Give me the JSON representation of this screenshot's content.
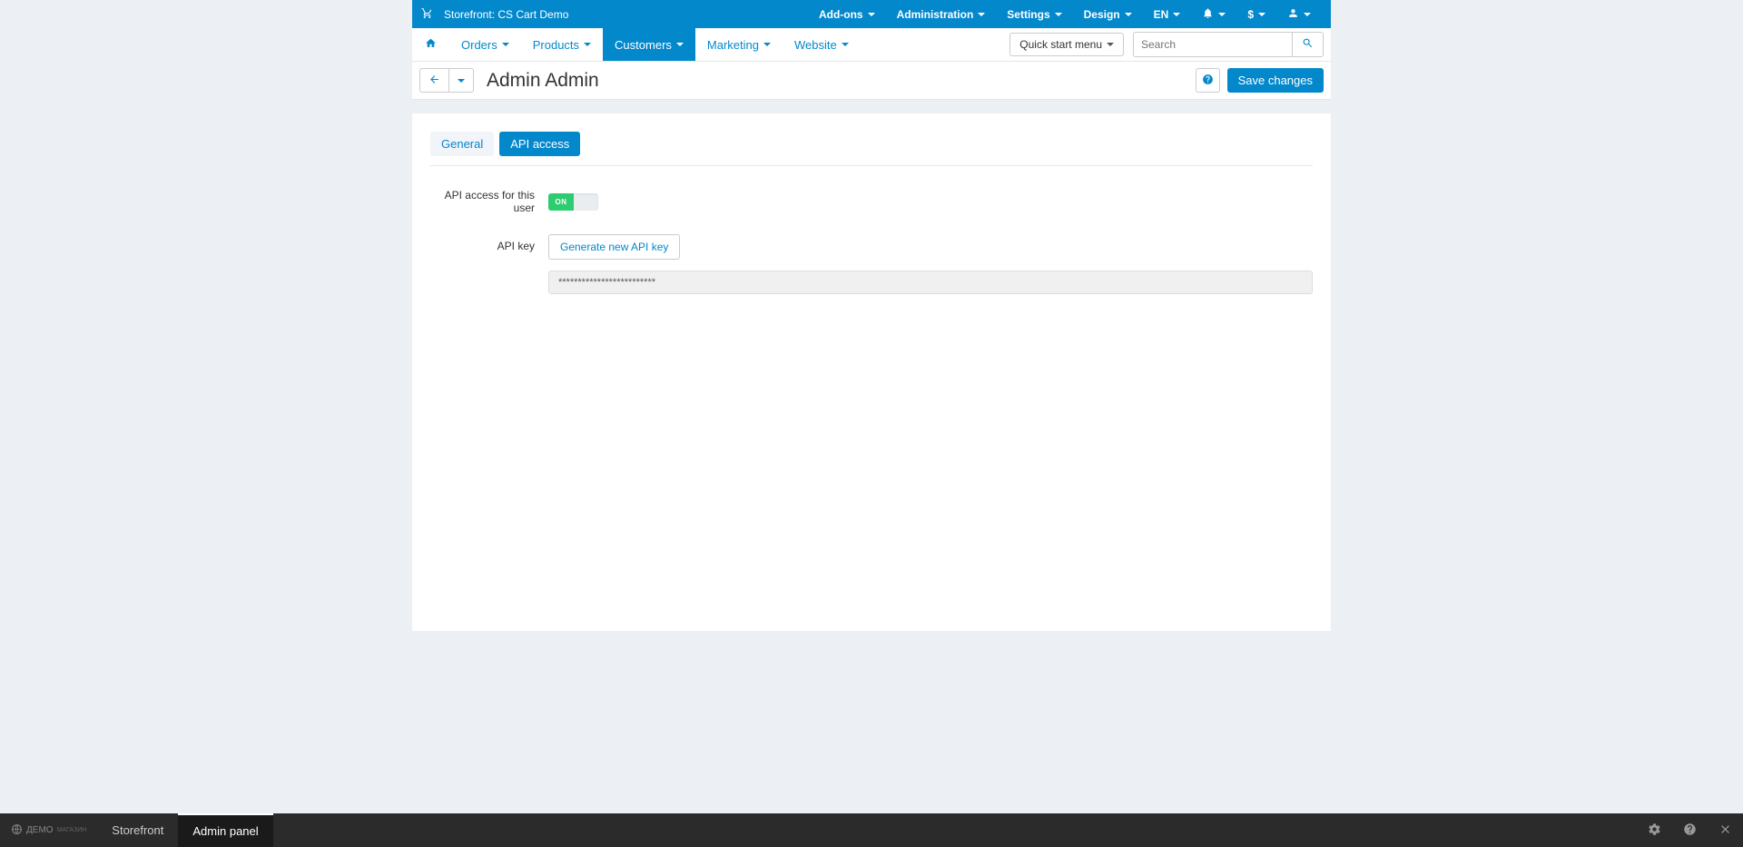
{
  "topbar": {
    "storefront_label": "Storefront: CS Cart Demo",
    "addons": "Add-ons",
    "administration": "Administration",
    "settings": "Settings",
    "design": "Design",
    "language": "EN",
    "currency": "$"
  },
  "menu": {
    "orders": "Orders",
    "products": "Products",
    "customers": "Customers",
    "marketing": "Marketing",
    "website": "Website",
    "quick_start": "Quick start menu",
    "search_placeholder": "Search"
  },
  "page": {
    "title": "Admin Admin",
    "save_label": "Save changes"
  },
  "tabs": {
    "general": "General",
    "api_access": "API access"
  },
  "form": {
    "api_access_label": "API access for this user",
    "toggle_on_text": "ON",
    "api_key_label": "API key",
    "generate_label": "Generate new API key",
    "key_value": "*************************"
  },
  "bottombar": {
    "demo": "ДЕМО",
    "demo_sub": "МАГАЗИН",
    "storefront": "Storefront",
    "admin_panel": "Admin panel"
  }
}
